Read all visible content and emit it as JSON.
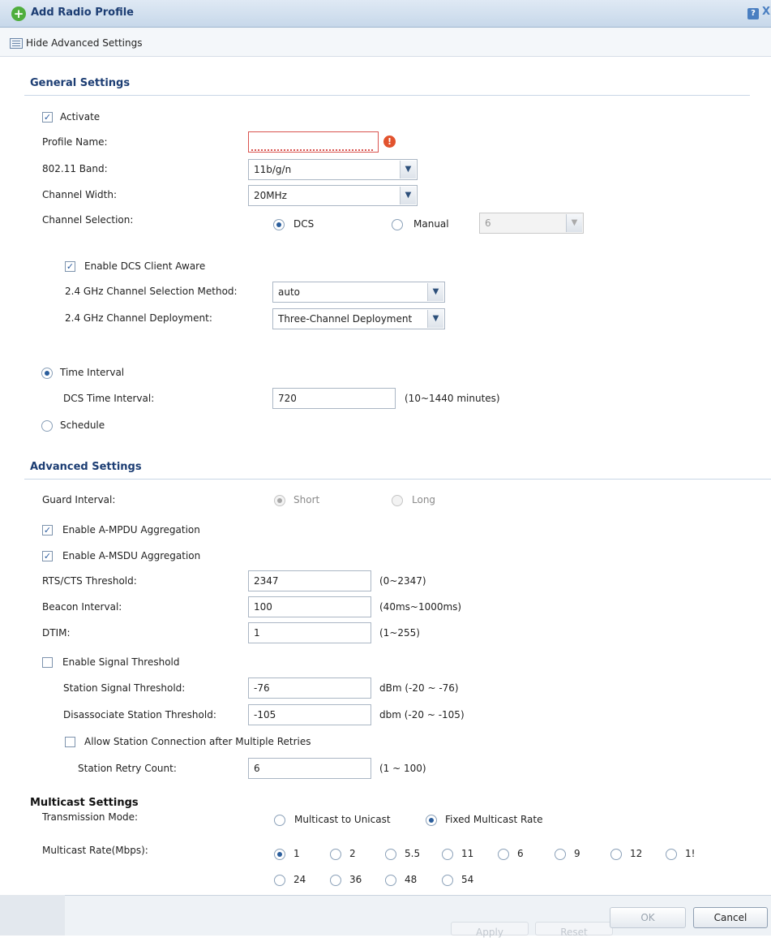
{
  "dialog": {
    "title": "Add Radio Profile",
    "help_label": "?",
    "close_label": "X",
    "add_icon": "plus-circle-icon"
  },
  "toolbar": {
    "hide_advanced_label": "Hide Advanced Settings"
  },
  "general": {
    "section_title": "General Settings",
    "activate_label": "Activate",
    "activate_checked": true,
    "profile_name_label": "Profile Name:",
    "profile_name_value": "",
    "band_label": "802.11 Band:",
    "band_value": "11b/g/n",
    "channel_width_label": "Channel Width:",
    "channel_width_value": "20MHz",
    "channel_selection_label": "Channel Selection:",
    "dcs_label": "DCS",
    "manual_label": "Manual",
    "manual_channel_value": "6",
    "selected_channel_mode": "DCS",
    "enable_dcs_client_aware_label": "Enable DCS Client Aware",
    "channel_selection_method_label": "2.4 GHz Channel Selection Method:",
    "channel_selection_method_value": "auto",
    "channel_deployment_label": "2.4 GHz Channel Deployment:",
    "channel_deployment_value": "Three-Channel Deployment",
    "time_interval_label": "Time Interval",
    "dcs_time_interval_label": "DCS Time Interval:",
    "dcs_time_interval_value": "720",
    "dcs_time_interval_hint": "(10~1440 minutes)",
    "schedule_label": "Schedule"
  },
  "advanced": {
    "section_title": "Advanced Settings",
    "guard_interval_label": "Guard Interval:",
    "short_label": "Short",
    "long_label": "Long",
    "ampdu_label": "Enable A-MPDU Aggregation",
    "amsdu_label": "Enable A-MSDU Aggregation",
    "rts_label": "RTS/CTS Threshold:",
    "rts_value": "2347",
    "rts_hint": "(0~2347)",
    "beacon_label": "Beacon Interval:",
    "beacon_value": "100",
    "beacon_hint": "(40ms~1000ms)",
    "dtim_label": "DTIM:",
    "dtim_value": "1",
    "dtim_hint": "(1~255)",
    "enable_signal_threshold_label": "Enable Signal Threshold",
    "station_signal_threshold_label": "Station Signal Threshold:",
    "station_signal_threshold_value": "-76",
    "station_signal_threshold_hint": "dBm (-20 ~ -76)",
    "disassociate_label": "Disassociate Station Threshold:",
    "disassociate_value": "-105",
    "disassociate_hint": "dbm (-20 ~ -105)",
    "allow_retries_label": "Allow Station Connection after Multiple Retries",
    "retry_count_label": "Station Retry Count:",
    "retry_count_value": "6",
    "retry_count_hint": "(1 ~ 100)"
  },
  "multicast": {
    "section_title": "Multicast Settings",
    "transmission_mode_label": "Transmission Mode:",
    "multicast_to_unicast_label": "Multicast to Unicast",
    "fixed_multicast_rate_label": "Fixed Multicast Rate",
    "rate_label": "Multicast Rate(Mbps):",
    "rates_row1": [
      "1",
      "2",
      "5.5",
      "11",
      "6",
      "9",
      "12",
      "1!"
    ],
    "rates_row2": [
      "24",
      "36",
      "48",
      "54"
    ],
    "selected_rate": "1"
  },
  "footer": {
    "ok_label": "OK",
    "cancel_label": "Cancel",
    "apply_label": "Apply",
    "reset_label": "Reset"
  },
  "colors": {
    "title": "#1c3d73",
    "accent": "#2b5e9c",
    "error": "#e2532e"
  }
}
